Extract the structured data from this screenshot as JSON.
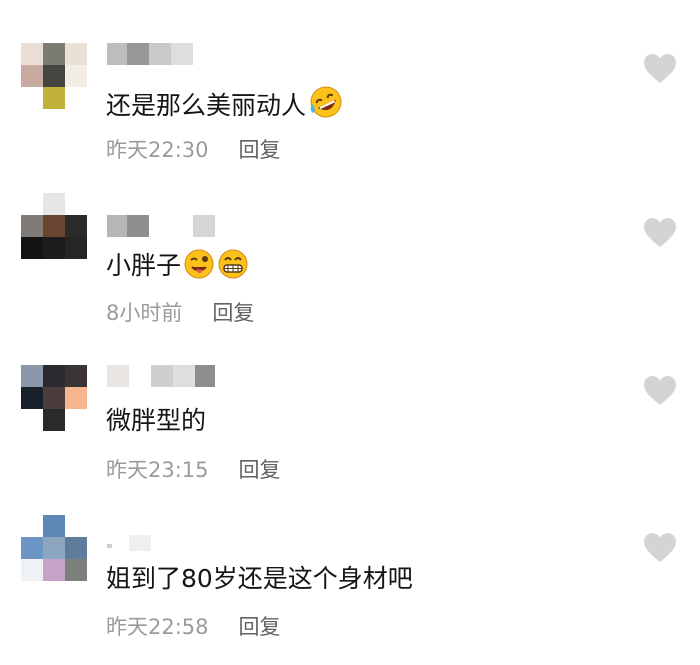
{
  "comments": [
    {
      "text": "还是那么美丽动人",
      "emojis": [
        "rolling-laughing-emoji"
      ],
      "time": "昨天22:30",
      "reply_label": "回复",
      "avatar_colors": [
        "#e9ddd6",
        "#7b7b72",
        "#e9e0d6",
        "#c9aaa0",
        "#454540",
        "#f3eee4",
        "#ffffff",
        "#c0b13a",
        "#ffffff"
      ]
    },
    {
      "text": "小胖子",
      "emojis": [
        "tongue-out-emoji",
        "grinning-teeth-emoji"
      ],
      "time": "8小时前",
      "reply_label": "回复",
      "avatar_colors": [
        "#ffffff",
        "#e6e6e6",
        "#ffffff",
        "#7f7b76",
        "#6b4531",
        "#2a2a2a",
        "#141414",
        "#1d1d1d",
        "#252525"
      ]
    },
    {
      "text": "微胖型的",
      "emojis": [],
      "time": "昨天23:15",
      "reply_label": "回复",
      "avatar_colors": [
        "#8a97a8",
        "#2a2a2e",
        "#3a3434",
        "#18202a",
        "#4a3c3a",
        "#f4b58f",
        "#ffffff",
        "#2a2a2a",
        "#ffffff"
      ]
    },
    {
      "text": "姐到了80岁还是这个身材吧",
      "emojis": [],
      "time": "昨天22:58",
      "reply_label": "回复",
      "avatar_colors": [
        "#ffffff",
        "#5f87b6",
        "#ffffff",
        "#6d96c5",
        "#8da6bf",
        "#5f7c9c",
        "#eef1f5",
        "#c6a2c6",
        "#7c7f7a"
      ]
    }
  ],
  "heart_icon": "heart-icon",
  "colors": {
    "text": "#151515",
    "meta": "#9b9b9b",
    "reply": "#626262",
    "heart": "#d4d4d4"
  }
}
